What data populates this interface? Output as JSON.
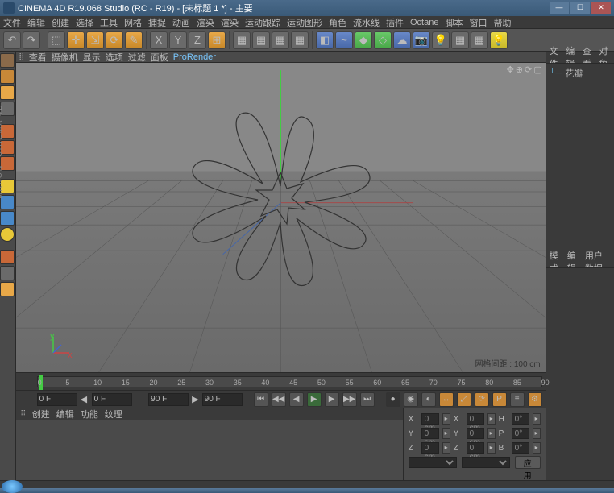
{
  "titlebar": {
    "text": "CINEMA 4D R19.068 Studio (RC - R19) - [未标题 1 *] - 主要"
  },
  "menubar": [
    "文件",
    "编辑",
    "创建",
    "选择",
    "工具",
    "网格",
    "捕捉",
    "动画",
    "渲染",
    "渲染",
    "运动跟踪",
    "运动图形",
    "角色",
    "流水线",
    "插件",
    "Octane",
    "脚本",
    "窗口",
    "帮助"
  ],
  "viewport_menus": [
    "查看",
    "摄像机",
    "显示",
    "选项",
    "过滤",
    "面板",
    "ProRender"
  ],
  "grid_label": "网格间距 : 100 cm",
  "timeline": {
    "start": "0 F",
    "mid": "0 F",
    "end_a": "90 F",
    "end_b": "90 F",
    "ticks": [
      "0",
      "5",
      "10",
      "15",
      "20",
      "25",
      "30",
      "35",
      "40",
      "45",
      "50",
      "55",
      "60",
      "65",
      "70",
      "75",
      "80",
      "85",
      "90"
    ]
  },
  "bottom_tabs_left": [
    "创建",
    "编辑",
    "功能",
    "纹理"
  ],
  "coords": {
    "row1": {
      "a": "X",
      "av": "0 cm",
      "b": "X",
      "bv": "0 cm",
      "c": "H",
      "cv": "0°"
    },
    "row2": {
      "a": "Y",
      "av": "0 cm",
      "b": "Y",
      "bv": "0 cm",
      "c": "P",
      "cv": "0°"
    },
    "row3": {
      "a": "Z",
      "av": "0 cm",
      "b": "Z",
      "bv": "0 cm",
      "c": "B",
      "cv": "0°"
    },
    "apply": "应用"
  },
  "right_tabs_top": [
    "文件",
    "编辑",
    "查看",
    "对象"
  ],
  "right_item": "花瓣",
  "right_tabs_mid": [
    "模式",
    "编辑",
    "用户数据"
  ]
}
